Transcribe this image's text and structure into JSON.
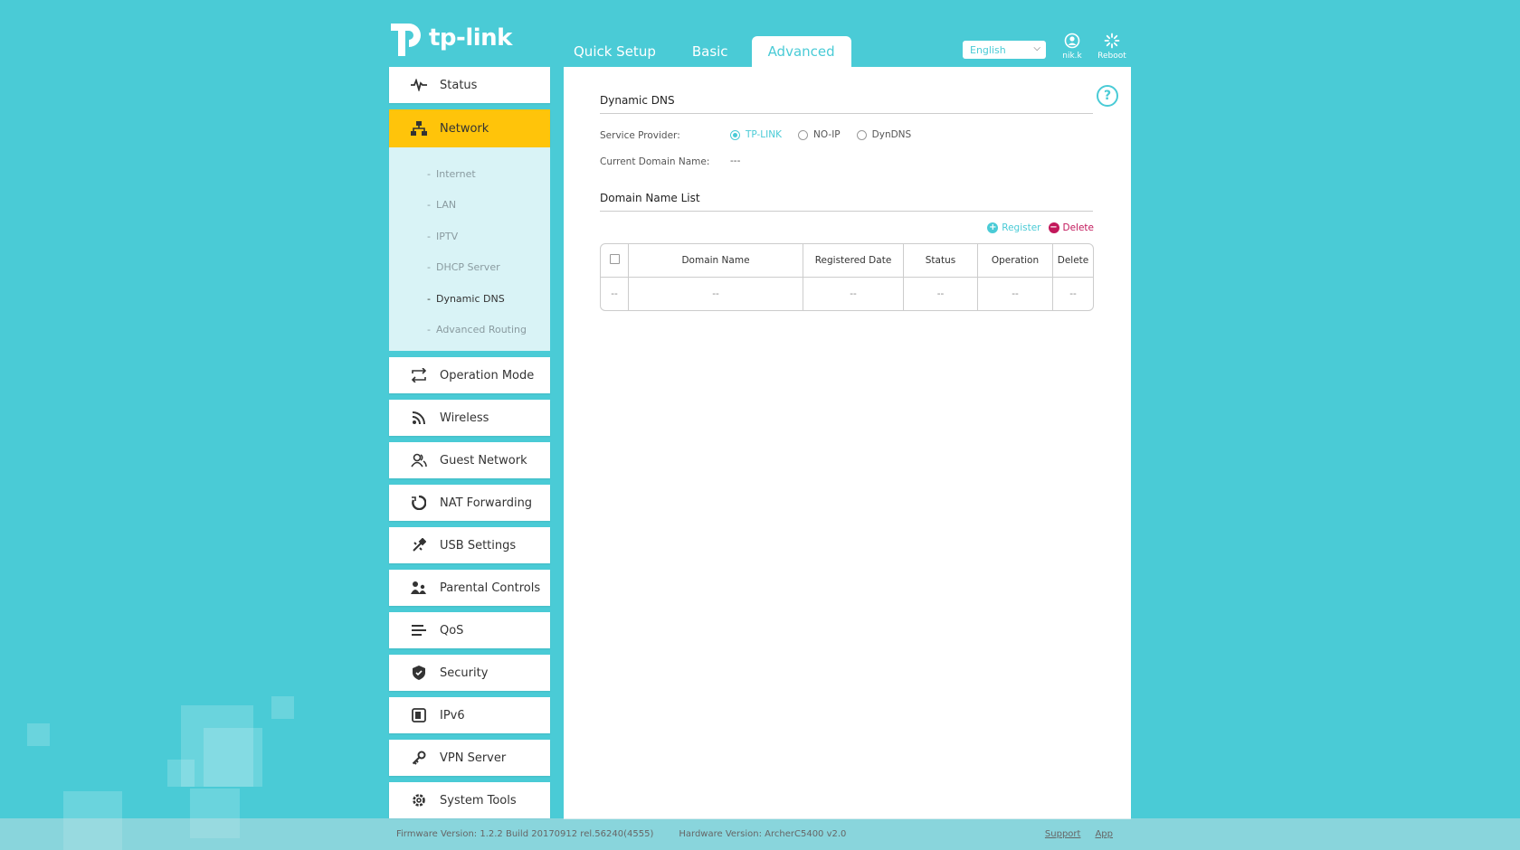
{
  "header": {
    "brand": "tp-link",
    "tabs": [
      {
        "label": "Quick Setup",
        "active": false
      },
      {
        "label": "Basic",
        "active": false
      },
      {
        "label": "Advanced",
        "active": true
      }
    ],
    "language": "English",
    "user_label": "nik.k",
    "reboot_label": "Reboot"
  },
  "sidebar": {
    "items": [
      {
        "label": "Status",
        "icon": "pulse-icon"
      },
      {
        "label": "Network",
        "icon": "network-icon",
        "active": true
      },
      {
        "label": "Operation Mode",
        "icon": "mode-icon"
      },
      {
        "label": "Wireless",
        "icon": "wifi-icon"
      },
      {
        "label": "Guest Network",
        "icon": "users-icon"
      },
      {
        "label": "NAT Forwarding",
        "icon": "nat-icon"
      },
      {
        "label": "USB Settings",
        "icon": "usb-icon"
      },
      {
        "label": "Parental Controls",
        "icon": "family-icon"
      },
      {
        "label": "QoS",
        "icon": "qos-icon"
      },
      {
        "label": "Security",
        "icon": "shield-icon"
      },
      {
        "label": "IPv6",
        "icon": "ipv6-icon"
      },
      {
        "label": "VPN Server",
        "icon": "key-icon"
      },
      {
        "label": "System Tools",
        "icon": "gear-icon"
      }
    ],
    "network_sub": [
      {
        "label": "Internet"
      },
      {
        "label": "LAN"
      },
      {
        "label": "IPTV"
      },
      {
        "label": "DHCP Server"
      },
      {
        "label": "Dynamic DNS",
        "active": true
      },
      {
        "label": "Advanced Routing"
      }
    ],
    "dash": "-"
  },
  "content": {
    "title": "Dynamic DNS",
    "service_provider_label": "Service Provider:",
    "providers": [
      "TP-LINK",
      "NO-IP",
      "DynDNS"
    ],
    "selected_provider": "TP-LINK",
    "current_domain_label": "Current Domain Name:",
    "current_domain_value": "---",
    "list_title": "Domain Name List",
    "register_label": "Register",
    "delete_label": "Delete",
    "table": {
      "columns": [
        "Domain Name",
        "Registered Date",
        "Status",
        "Operation",
        "Delete"
      ],
      "row": [
        "--",
        "--",
        "--",
        "--",
        "--",
        "--"
      ]
    },
    "help": "?"
  },
  "footer": {
    "firmware": "Firmware Version: 1.2.2 Build 20170912 rel.56240(4555)",
    "hardware": "Hardware Version: ArcherC5400 v2.0",
    "support": "Support",
    "app": "App"
  },
  "colors": {
    "accent": "#4acbd6",
    "active_nav": "#ffc40a",
    "delete": "#c2185b"
  }
}
